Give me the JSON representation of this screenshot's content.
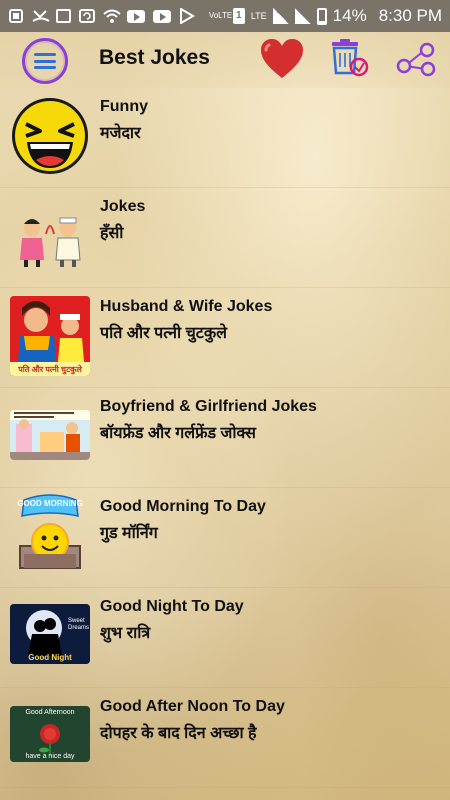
{
  "status_bar": {
    "time": "8:30 PM",
    "battery": "14%",
    "network_label": "LTE",
    "volte_label": "VoLTE",
    "sim_label": "1"
  },
  "app_bar": {
    "title": "Best Jokes",
    "icons": [
      "menu-icon",
      "heart-icon",
      "basket-icon",
      "share-icon"
    ],
    "menu_color": "#8a3fd8",
    "heart_color": "#d32f2f"
  },
  "categories": [
    {
      "title": "Funny",
      "subtitle": "मजेदार",
      "icon": "laughing-face-icon"
    },
    {
      "title": "Jokes",
      "subtitle": "हँसी",
      "icon": "cartoon-couple-icon"
    },
    {
      "title": "Husband & Wife Jokes",
      "subtitle": "पति और पत्नी चुटकुले",
      "icon": "husband-wife-cartoon-icon",
      "thumb_caption": "पति और पत्नी चुटकुले"
    },
    {
      "title": "Boyfriend & Girlfriend Jokes",
      "subtitle": "बॉयफ्रेंड और गर्लफ्रेंड जोक्स",
      "icon": "boyfriend-girlfriend-cartoon-icon"
    },
    {
      "title": "Good Morning To Day",
      "subtitle": "गुड मॉर्निंग",
      "icon": "good-morning-smiley-icon",
      "thumb_caption": "GOOD MORNING"
    },
    {
      "title": "Good Night To Day",
      "subtitle": "शुभ रात्रि",
      "icon": "good-night-couple-icon",
      "thumb_caption": "Good Night",
      "thumb_caption2": "Sweet Dreams"
    },
    {
      "title": "Good After Noon To Day",
      "subtitle": "दोपहर के बाद दिन अच्छा है",
      "icon": "good-afternoon-rose-icon",
      "thumb_caption": "Good Afternoon",
      "thumb_caption2": "have a nice day"
    }
  ]
}
